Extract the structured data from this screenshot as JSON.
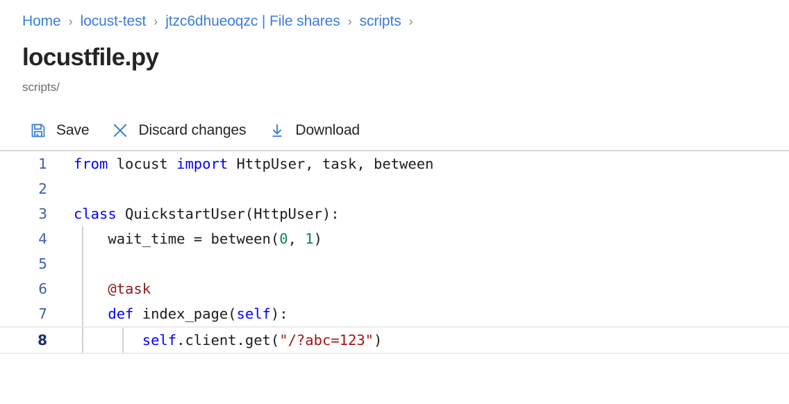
{
  "breadcrumb": {
    "separator": "›",
    "items": [
      {
        "label": "Home"
      },
      {
        "label": "locust-test"
      },
      {
        "label": "jtzc6dhueoqzc | File shares"
      },
      {
        "label": "scripts"
      }
    ],
    "trailing_separator": "›"
  },
  "header": {
    "title": "locustfile.py",
    "subtitle": "scripts/"
  },
  "toolbar": {
    "save_label": "Save",
    "discard_label": "Discard changes",
    "download_label": "Download"
  },
  "editor": {
    "active_line": 8,
    "lines": [
      {
        "number": "1",
        "indent_guides": 0,
        "tokens": [
          {
            "text": "from",
            "type": "kw"
          },
          {
            "text": " locust ",
            "type": "txt"
          },
          {
            "text": "import",
            "type": "kw"
          },
          {
            "text": " HttpUser, task, between",
            "type": "txt"
          }
        ]
      },
      {
        "number": "2",
        "indent_guides": 0,
        "tokens": []
      },
      {
        "number": "3",
        "indent_guides": 0,
        "tokens": [
          {
            "text": "class",
            "type": "kw"
          },
          {
            "text": " QuickstartUser(HttpUser):",
            "type": "txt"
          }
        ]
      },
      {
        "number": "4",
        "indent_guides": 1,
        "tokens": [
          {
            "text": "    wait_time = between(",
            "type": "txt"
          },
          {
            "text": "0",
            "type": "num"
          },
          {
            "text": ", ",
            "type": "txt"
          },
          {
            "text": "1",
            "type": "num"
          },
          {
            "text": ")",
            "type": "txt"
          }
        ]
      },
      {
        "number": "5",
        "indent_guides": 1,
        "tokens": []
      },
      {
        "number": "6",
        "indent_guides": 1,
        "tokens": [
          {
            "text": "    @task",
            "type": "dec"
          }
        ]
      },
      {
        "number": "7",
        "indent_guides": 1,
        "tokens": [
          {
            "text": "    ",
            "type": "txt"
          },
          {
            "text": "def",
            "type": "kw"
          },
          {
            "text": " index_page(",
            "type": "txt"
          },
          {
            "text": "self",
            "type": "self"
          },
          {
            "text": "):",
            "type": "txt"
          }
        ]
      },
      {
        "number": "8",
        "indent_guides": 2,
        "tokens": [
          {
            "text": "        ",
            "type": "txt"
          },
          {
            "text": "self",
            "type": "self"
          },
          {
            "text": ".client.get(",
            "type": "txt"
          },
          {
            "text": "\"/?abc=123\"",
            "type": "str"
          },
          {
            "text": ")",
            "type": "txt"
          }
        ]
      }
    ]
  },
  "icons": {
    "save": "floppy-disk-icon",
    "discard": "close-x-icon",
    "download": "download-arrow-icon"
  },
  "colors": {
    "link": "#3b7dd8",
    "icon_blue": "#3b7dd8",
    "keyword": "#0000ff",
    "string": "#a31515",
    "number": "#098658",
    "decorator": "#8b1a1a"
  }
}
